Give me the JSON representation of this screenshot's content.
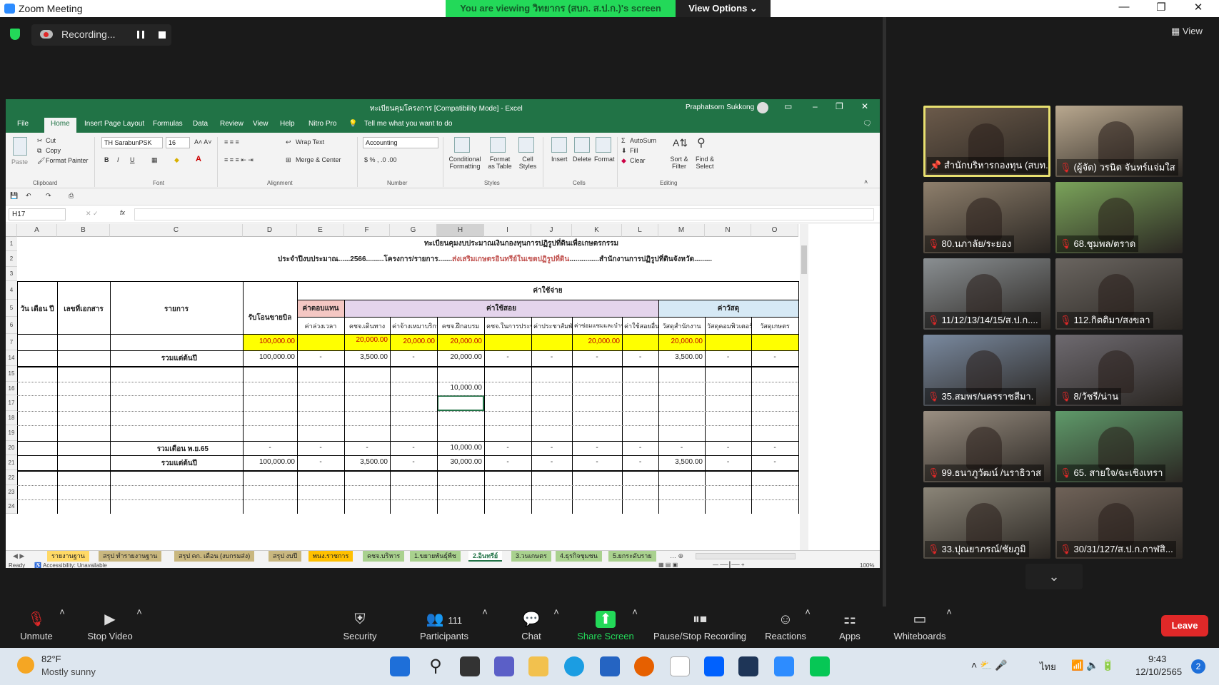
{
  "zoom": {
    "window_title": "Zoom Meeting",
    "viewing_banner": "You are viewing วิทยากร (สบก. ส.ป.ก.)'s screen",
    "view_options": "View Options ⌄",
    "recording_label": "Recording...",
    "view_label": "View",
    "window_controls": [
      "—",
      "❐",
      "✕"
    ]
  },
  "excel": {
    "doc_title": "ทะเบียนคุมโครงการ [Compatibility Mode] - Excel",
    "user_name": "Praphatsorn Sukkong",
    "tabs": [
      "File",
      "Home",
      "Insert",
      "Page Layout",
      "Formulas",
      "Data",
      "Review",
      "View",
      "Help",
      "Nitro Pro"
    ],
    "tell_me": "Tell me what you want to do",
    "ribbon": {
      "cut": "Cut",
      "copy": "Copy",
      "format_painter": "Format Painter",
      "paste": "Paste",
      "font_name": "TH SarabunPSK",
      "font_size": "16",
      "wrap_text": "Wrap Text",
      "merge_center": "Merge & Center",
      "number_format": "Accounting",
      "conditional_formatting": "Conditional Formatting",
      "format_as_table": "Format as Table",
      "cell_styles": "Cell Styles",
      "insert": "Insert",
      "delete": "Delete",
      "format": "Format",
      "autosum": "AutoSum",
      "fill": "Fill",
      "clear": "Clear",
      "sort_filter": "Sort & Filter",
      "find_select": "Find & Select",
      "groups": [
        "Clipboard",
        "Font",
        "Alignment",
        "Number",
        "Styles",
        "Cells",
        "Editing"
      ]
    },
    "name_box": "H17",
    "fx": "fx",
    "columns": [
      "A",
      "B",
      "C",
      "D",
      "E",
      "F",
      "G",
      "H",
      "I",
      "J",
      "K",
      "L",
      "M",
      "N",
      "O"
    ],
    "rows": [
      "1",
      "2",
      "3",
      "4",
      "5",
      "6",
      "7",
      "14",
      "15",
      "16",
      "17",
      "18",
      "19",
      "20",
      "21",
      "22",
      "23",
      "24"
    ],
    "sheet": {
      "title1": "ทะเบียนคุมงบประมาณเงินกองทุนการปฏิรูปที่ดินเพื่อเกษตรกรรม",
      "title2_prefix": "ประจำปีงบประมาณ......2566.........โครงการ/รายการ.......",
      "title2_project": "ส่งเสริมเกษตรอินทรีย์ในเขตปฏิรูปที่ดิน",
      "title2_suffix": "...............สำนักงานการปฏิรูปที่ดินจังหวัด.........",
      "h_date": "วัน เดือน ปี",
      "h_doc": "เลขที่เอกสาร",
      "h_item": "รายการ",
      "h_receive": "รับโอนขายบิล",
      "h_expense": "ค่าใช้จ่าย",
      "h_compensation": "ค่าตอบแทน",
      "h_operation": "ค่าใช้สอย",
      "h_materials": "ค่าวัสดุ",
      "sub": [
        "ค่าล่วงเวลา",
        "คชจ.เดินทาง",
        "ค่าจ้างเหมาบริการ",
        "คชจ.ฝึกอบรม",
        "คชจ.ในการประชุม",
        "ค่าประชาสัมพันธ์",
        "ค่าซ่อมแซมและบำรุงรักษา",
        "ค่าใช้สอยอื่น",
        "วัสดุสำนักงาน",
        "วัสดุคอมพิวเตอร์",
        "วัสดุเกษตร"
      ],
      "row7": [
        "100,000.00",
        "",
        "20,000.00",
        "20,000.00",
        "20,000.00",
        "",
        "",
        "20,000.00",
        "",
        "20,000.00",
        "",
        ""
      ],
      "row14_label": "รวมแต่ต้นปี",
      "row14": [
        "100,000.00",
        "-",
        "3,500.00",
        "-",
        "20,000.00",
        "-",
        "-",
        "-",
        "-",
        "3,500.00",
        "-",
        "-"
      ],
      "row16_h": "10,000.00",
      "row20_label": "รวมเดือน พ.ย.65",
      "row20": [
        "-",
        "-",
        "-",
        "-",
        "10,000.00",
        "-",
        "-",
        "-",
        "-",
        "-",
        "-",
        "-"
      ],
      "row21_label": "รวมแต่ต้นปี",
      "row21": [
        "100,000.00",
        "-",
        "3,500.00",
        "-",
        "30,000.00",
        "-",
        "-",
        "-",
        "-",
        "3,500.00",
        "-",
        "-"
      ]
    },
    "sheet_tabs": [
      "รายงานฐาน",
      "สรุป ทำรายงานฐาน",
      "สรุป คก. เดือน (งบกรมส่ง)",
      "สรุป งบปี",
      "พนง.ราชการ",
      "คชจ.บริหาร",
      "1.ขยายพันธุ์พืช",
      "2.อินทรีย์",
      "3.วนเกษตร",
      "4.ธุรกิจชุมชน",
      "5.ยกระดับราย"
    ],
    "active_sheet": "2.อินทรีย์",
    "status_ready": "Ready",
    "status_accessibility": "Accessibility: Unavailable",
    "zoom_pct": "100%"
  },
  "gallery": [
    {
      "name": "สำนักบริหารกองทุน (สบท.)",
      "muted": false,
      "pinned": true,
      "color": "#6b5a4a"
    },
    {
      "name": "(ผู้จัด) วรนิต จันทร์แจ่มใส",
      "muted": true,
      "pinned": false,
      "color": "#b9a88f"
    },
    {
      "name": "80.นภาลัย/ระยอง",
      "muted": true,
      "pinned": false,
      "color": "#8e7f6c"
    },
    {
      "name": "68.ชุมพล/ตราด",
      "muted": true,
      "pinned": false,
      "color": "#7aa35a"
    },
    {
      "name": "11/12/13/14/15/ส.ป.ก....",
      "muted": true,
      "pinned": false,
      "color": "#8a8f92"
    },
    {
      "name": "112.กิตติมา/สงขลา",
      "muted": true,
      "pinned": false,
      "color": "#6a6560"
    },
    {
      "name": "35.สมพร/นครราชสีมา.",
      "muted": true,
      "pinned": false,
      "color": "#7a8aa0"
    },
    {
      "name": "8/วัชรี/น่าน",
      "muted": true,
      "pinned": false,
      "color": "#6e6a70"
    },
    {
      "name": "99.ธนาภูวัฒน์ /นราธิวาส",
      "muted": true,
      "pinned": false,
      "color": "#9a8f82"
    },
    {
      "name": "65. สายใจ/ฉะเชิงเทรา",
      "muted": true,
      "pinned": false,
      "color": "#5f9a6a"
    },
    {
      "name": "33.ปุณยาภรณ์/ชัยภูมิ",
      "muted": true,
      "pinned": false,
      "color": "#8b8578"
    },
    {
      "name": "30/31/127/ส.ป.ก.กาฬสิ...",
      "muted": true,
      "pinned": false,
      "color": "#6f6258"
    }
  ],
  "toolbar": {
    "unmute": "Unmute",
    "stop_video": "Stop Video",
    "security": "Security",
    "participants": "Participants",
    "participants_count": "111",
    "chat": "Chat",
    "share_screen": "Share Screen",
    "pause_stop_recording": "Pause/Stop Recording",
    "reactions": "Reactions",
    "apps": "Apps",
    "whiteboards": "Whiteboards",
    "leave": "Leave"
  },
  "taskbar": {
    "temp": "82°F",
    "weather": "Mostly sunny",
    "lang": "ไทย",
    "time": "9:43",
    "date": "12/10/2565",
    "badge": "2"
  },
  "colors": {
    "zoom_green": "#23d959",
    "excel_green": "#217346",
    "leave_red": "#e02828",
    "yellow_row": "#ffff00",
    "pink_header": "#f4c7c3",
    "purple_header": "#e4d4ec",
    "blue_header": "#d6e9f5"
  }
}
